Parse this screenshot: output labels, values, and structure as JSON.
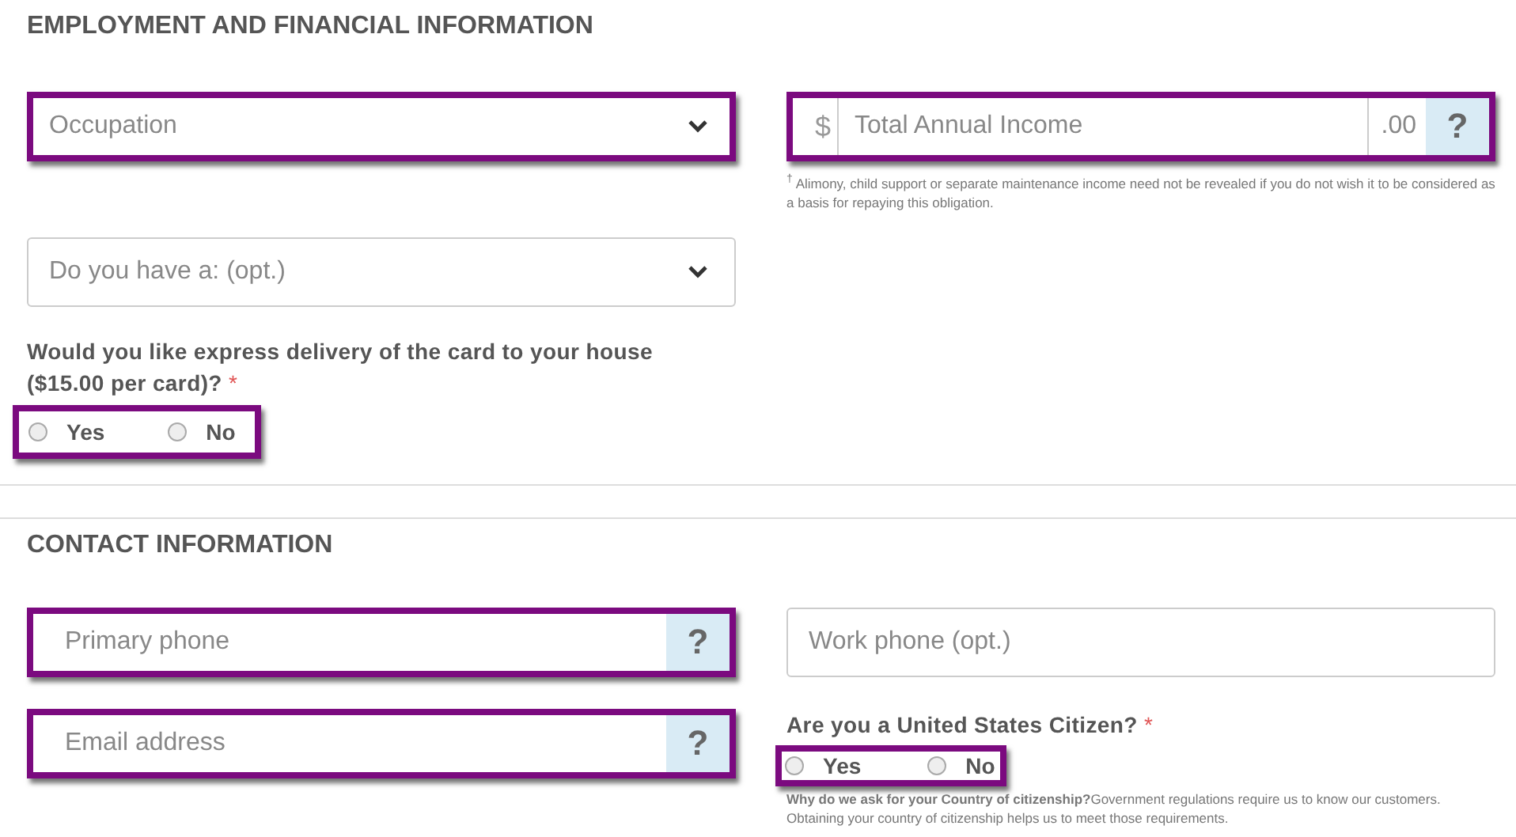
{
  "employment": {
    "title": "EMPLOYMENT AND FINANCIAL INFORMATION",
    "occupation": {
      "placeholder": "Occupation",
      "highlighted": true
    },
    "income": {
      "prefix": "$",
      "placeholder": "Total Annual Income",
      "suffix": ".00",
      "help": "?",
      "highlighted": true,
      "note": "$^{†}$ Alimony, child support or separate maintenance income need not be revealed if you do not wish it to be considered as a basis for repaying this obligation."
    },
    "have": {
      "placeholder": "Do you have a: (opt.)",
      "highlighted": false
    },
    "delivery": {
      "question": "Would you like express delivery of the card to your house ($15.00 per card)?",
      "required": "*",
      "highlighted": true,
      "options": [
        {
          "label": "Yes",
          "selected": false
        },
        {
          "label": "No",
          "selected": false
        }
      ]
    }
  },
  "contact": {
    "title": "CONTACT INFORMATION",
    "primary_phone": {
      "placeholder": "Primary phone",
      "help": "?",
      "highlighted": true
    },
    "work_phone": {
      "placeholder": "Work phone (opt.)",
      "highlighted": false
    },
    "email": {
      "placeholder": "Email address",
      "help": "?",
      "highlighted": true
    },
    "citizen": {
      "question": "Are you a United States Citizen?",
      "required": "*",
      "highlighted": true,
      "options": [
        {
          "label": "Yes",
          "selected": false
        },
        {
          "label": "No",
          "selected": false
        }
      ],
      "note": "**Why do we ask for your Country of citizenship?**Government regulations require us to know our customers. Obtaining your country of citizenship helps us to meet those requirements."
    }
  }
}
